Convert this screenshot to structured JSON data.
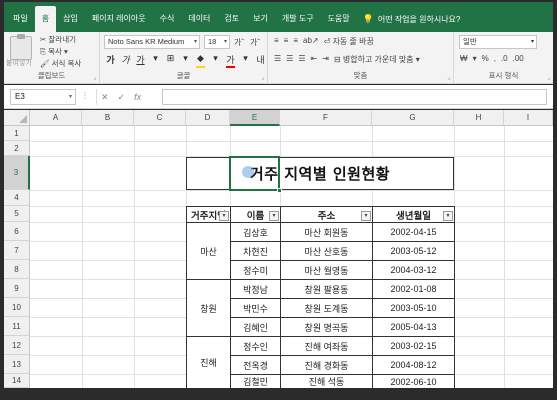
{
  "ribbon_tabs": [
    "파일",
    "홈",
    "삽입",
    "페이지 레이아웃",
    "수식",
    "데이터",
    "검토",
    "보기",
    "개발 도구",
    "도움말"
  ],
  "tell_me": "어떤 작업을 원하시나요?",
  "clipboard": {
    "paste_label": "붙여넣기",
    "cut": "잘라내기",
    "copy": "복사",
    "format_painter": "서식 복사",
    "group_label": "클립보드"
  },
  "font": {
    "name": "Noto Sans KR Medium",
    "size": "18",
    "group_label": "글꼴",
    "bold": "가",
    "italic": "가",
    "underline": "가",
    "font_color_glyph": "가"
  },
  "alignment": {
    "wrap_text": "자동 줄 바꿈",
    "merge_center": "병합하고 가운데 맞춤",
    "group_label": "맞춤"
  },
  "number": {
    "format": "일반",
    "group_label": "표시 형식"
  },
  "name_box": "E3",
  "columns": [
    "A",
    "B",
    "C",
    "D",
    "E",
    "F",
    "G",
    "H",
    "I"
  ],
  "rows": [
    "1",
    "2",
    "3",
    "4",
    "5",
    "6",
    "7",
    "8",
    "9",
    "10",
    "11",
    "12",
    "13",
    "14"
  ],
  "table": {
    "title": "거주 지역별 인원현황",
    "headers": [
      "거주지역",
      "이름",
      "주소",
      "생년월일"
    ],
    "regions": [
      "마산",
      "창원",
      "진해"
    ],
    "rows": [
      {
        "name": "김상호",
        "address": "마산 회원동",
        "birth": "2002-04-15"
      },
      {
        "name": "차현진",
        "address": "마산 산호동",
        "birth": "2003-05-12"
      },
      {
        "name": "정수미",
        "address": "마산 월영동",
        "birth": "2004-03-12"
      },
      {
        "name": "박정남",
        "address": "창원 팔용동",
        "birth": "2002-01-08"
      },
      {
        "name": "박민수",
        "address": "창원 도계동",
        "birth": "2003-05-10"
      },
      {
        "name": "김혜인",
        "address": "창원 명곡동",
        "birth": "2005-04-13"
      },
      {
        "name": "정수인",
        "address": "진해 여좌동",
        "birth": "2003-02-15"
      },
      {
        "name": "전옥경",
        "address": "진해 경화동",
        "birth": "2004-08-12"
      },
      {
        "name": "김철민",
        "address": "진해 석동",
        "birth": "2002-06-10"
      }
    ]
  },
  "colors": {
    "accent": "#217346"
  }
}
